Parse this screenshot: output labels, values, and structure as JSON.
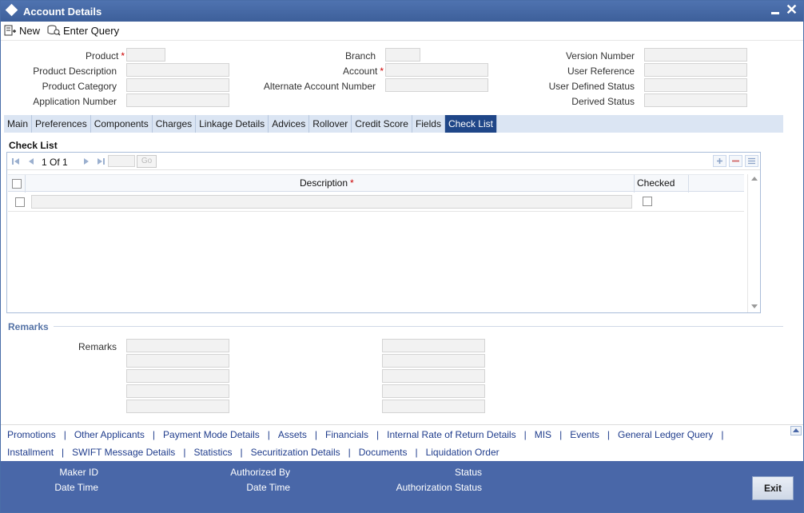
{
  "window": {
    "title": "Account Details"
  },
  "toolbar": {
    "new_label": "New",
    "enter_query_label": "Enter Query"
  },
  "header": {
    "product": "Product",
    "product_description": "Product Description",
    "product_category": "Product Category",
    "application_number": "Application Number",
    "branch": "Branch",
    "account": "Account",
    "alternate_account_number": "Alternate Account Number",
    "version_number": "Version Number",
    "user_reference": "User Reference",
    "user_defined_status": "User Defined Status",
    "derived_status": "Derived Status",
    "required_mark": "*"
  },
  "tabs": [
    {
      "label": "Main"
    },
    {
      "label": "Preferences"
    },
    {
      "label": "Components"
    },
    {
      "label": "Charges"
    },
    {
      "label": "Linkage Details"
    },
    {
      "label": "Advices"
    },
    {
      "label": "Rollover"
    },
    {
      "label": "Credit Score"
    },
    {
      "label": "Fields"
    },
    {
      "label": "Check List"
    }
  ],
  "active_tab": "Check List",
  "checklist": {
    "section_title": "Check List",
    "pager": {
      "text": "1 Of 1",
      "go_label": "Go"
    },
    "columns": {
      "description": "Description",
      "checked": "Checked"
    },
    "required_mark": "*"
  },
  "remarks": {
    "section_title": "Remarks",
    "label": "Remarks"
  },
  "links": {
    "row1": [
      "Promotions",
      "Other Applicants",
      "Payment Mode Details",
      "Assets",
      "Financials",
      "Internal Rate of Return Details",
      "MIS",
      "Events",
      "General Ledger Query"
    ],
    "row2": [
      "Installment",
      "SWIFT Message Details",
      "Statistics",
      "Securitization Details",
      "Documents",
      "Liquidation Order"
    ],
    "separator": "|"
  },
  "footer": {
    "maker_id": "Maker ID",
    "date_time": "Date Time",
    "authorized_by": "Authorized By",
    "date_time_2": "Date Time",
    "status": "Status",
    "authorization_status": "Authorization Status",
    "exit_label": "Exit"
  },
  "colors": {
    "titlebar": "#4a6ea8",
    "active_tab": "#1f4688",
    "footer": "#4967a8",
    "link": "#1f3c8c",
    "required": "#cc0000"
  }
}
